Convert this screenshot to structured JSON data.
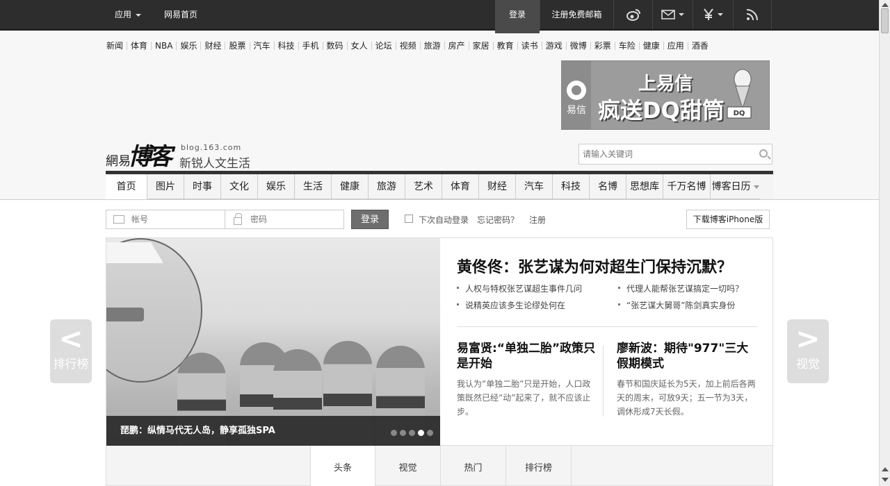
{
  "topbar": {
    "apps_label": "应用",
    "home_label": "网易首页",
    "login_label": "登录",
    "register_mail_label": "注册免费邮箱"
  },
  "channels": [
    "新闻",
    "体育",
    "NBA",
    "娱乐",
    "财经",
    "股票",
    "汽车",
    "科技",
    "手机",
    "数码",
    "女人",
    "论坛",
    "视频",
    "旅游",
    "房产",
    "家居",
    "教育",
    "读书",
    "游戏",
    "微博",
    "彩票",
    "车险",
    "健康",
    "应用",
    "酒香"
  ],
  "ad": {
    "brand": "易信",
    "line1": "上易信",
    "line2": "疯送DQ甜筒",
    "dq": "DQ"
  },
  "logo": {
    "net": "網易",
    "bo": "博客",
    "domain": "blog.163.com",
    "slogan": "新锐人文生活"
  },
  "search": {
    "placeholder": "请输入关键词"
  },
  "mainnav": [
    "首页",
    "图片",
    "时事",
    "文化",
    "娱乐",
    "生活",
    "健康",
    "旅游",
    "艺术",
    "体育",
    "财经",
    "汽车",
    "科技",
    "名博",
    "思想库",
    "千万名博",
    "博客日历"
  ],
  "login": {
    "account_placeholder": "帐号",
    "password_placeholder": "密码",
    "submit": "登录",
    "auto_login": "下次自动登录",
    "forgot": "忘记密码？",
    "register": "注册",
    "iphone": "下载博客iPhone版"
  },
  "feature": {
    "caption": "琵鹏：纵情马代无人岛，静享孤独SPA",
    "headline": "黄佟佟：张艺谋为何对超生门保持沉默？",
    "bullets": [
      "人权与特权张艺谋超生事件几问",
      "代理人能帮张艺谋搞定一切吗？",
      "说精英应该多生论缪处何在",
      "“张艺谋大舅哥”陈剑真实身份"
    ],
    "sub1": {
      "title": "易富贤:“单独二胎”政策只是开始",
      "text": "我认为“单独二胎”只是开始，人口政策既然已经“动”起来了，就不应该止步。"
    },
    "sub2": {
      "title": "廖新波：期待\"977\"三大假期模式",
      "text": "春节和国庆延长为5天，加上前后各两天的周末，可放9天；五一节为3天，调休形成7天长假。"
    }
  },
  "side": {
    "left_arrow": "<",
    "left_label": "排行榜",
    "right_arrow": ">",
    "right_label": "视觉"
  },
  "tabs": [
    "头条",
    "视觉",
    "热门",
    "排行榜"
  ]
}
